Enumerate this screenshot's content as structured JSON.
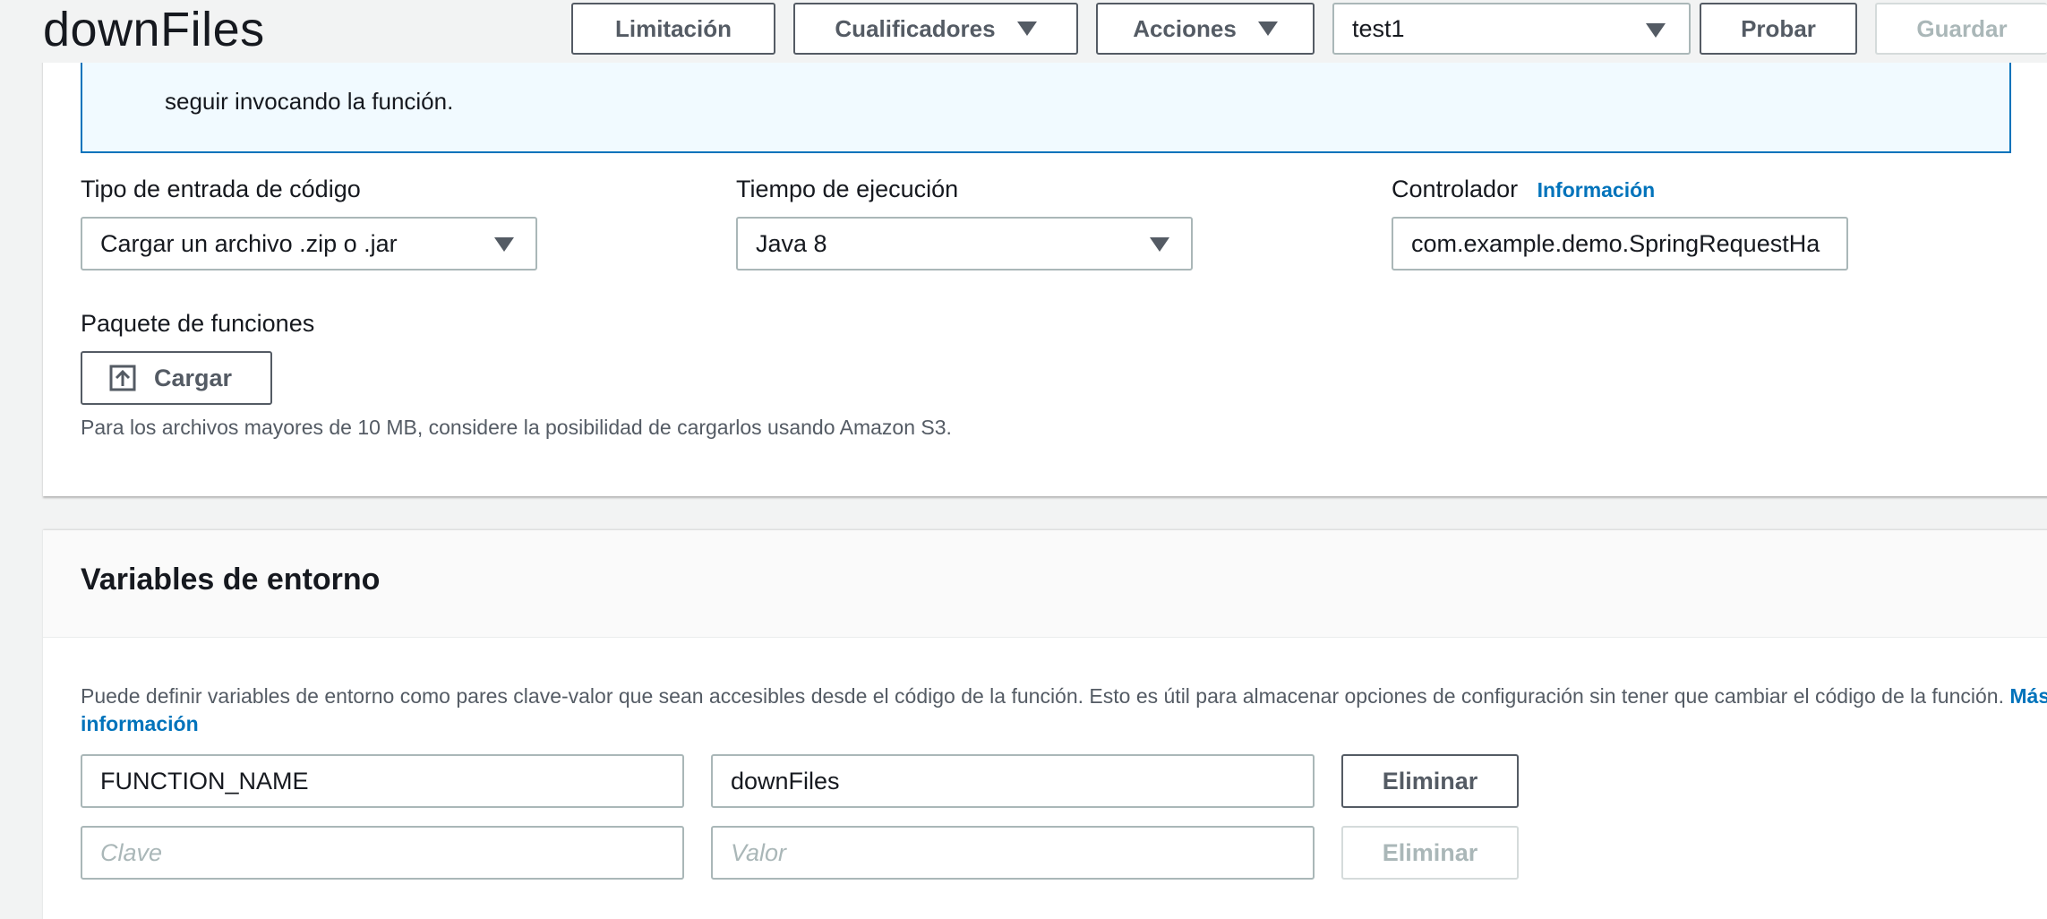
{
  "header": {
    "title": "downFiles",
    "buttons": {
      "throttle": "Limitación",
      "qualifiers": "Cualificadores",
      "actions": "Acciones",
      "test": "Probar",
      "save": "Guardar"
    },
    "test_event_select": "test1"
  },
  "alert": {
    "text": "seguir invocando la función."
  },
  "code": {
    "entry_type_label": "Tipo de entrada de código",
    "entry_type_value": "Cargar un archivo .zip o .jar",
    "runtime_label": "Tiempo de ejecución",
    "runtime_value": "Java 8",
    "handler_label": "Controlador",
    "handler_info_link": "Información",
    "handler_value": "com.example.demo.SpringRequestHa",
    "package_label": "Paquete de funciones",
    "upload_button": "Cargar",
    "upload_hint": "Para los archivos mayores de 10 MB, considere la posibilidad de cargarlos usando Amazon S3."
  },
  "env": {
    "title": "Variables de entorno",
    "description": "Puede definir variables de entorno como pares clave-valor que sean accesibles desde el código de la función. Esto es útil para almacenar opciones de configuración sin tener que cambiar el código de la función.",
    "more_info_link": "Más información",
    "rows": [
      {
        "key": "FUNCTION_NAME",
        "value": "downFiles",
        "remove": "Eliminar"
      }
    ],
    "new_row": {
      "key_placeholder": "Clave",
      "value_placeholder": "Valor",
      "remove": "Eliminar"
    }
  },
  "colors": {
    "accent_link": "#0073bb",
    "alert_bg": "#f1faff",
    "border": "#aab7b8",
    "button_text": "#545b64"
  }
}
